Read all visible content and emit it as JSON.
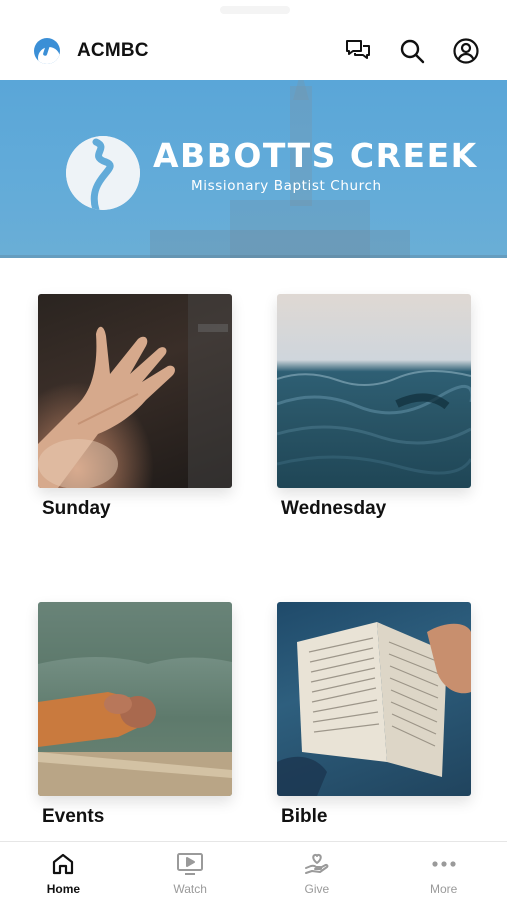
{
  "header": {
    "app_title": "ACMBC",
    "icons": [
      "app-logo-icon",
      "chat-icon",
      "search-icon",
      "account-icon"
    ]
  },
  "banner": {
    "church_name": "ABBOTTS CREEK",
    "church_subtitle": "Missionary Baptist Church"
  },
  "tiles": [
    {
      "label": "Sunday",
      "image": "open-hand-photo"
    },
    {
      "label": "Wednesday",
      "image": "ocean-water-photo"
    },
    {
      "label": "Events",
      "image": "praying-hands-photo"
    },
    {
      "label": "Bible",
      "image": "open-bible-photo"
    }
  ],
  "tabbar": {
    "items": [
      {
        "label": "Home",
        "icon": "home-icon",
        "active": true
      },
      {
        "label": "Watch",
        "icon": "watch-icon",
        "active": false
      },
      {
        "label": "Give",
        "icon": "give-icon",
        "active": false
      },
      {
        "label": "More",
        "icon": "more-icon",
        "active": false
      }
    ]
  },
  "colors": {
    "banner_blue": "#5aa6d8",
    "active_tab": "#111111",
    "inactive_tab": "#9a9a9a"
  }
}
